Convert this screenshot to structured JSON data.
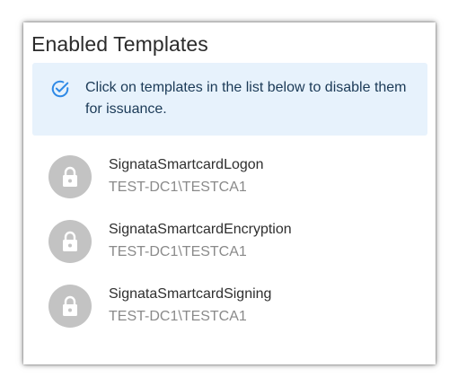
{
  "panel": {
    "title": "Enabled Templates"
  },
  "info": {
    "icon": "check-circle-icon",
    "accent_color": "#2f8ae6",
    "message": "Click on templates in the list below to disable them for issuance."
  },
  "templates": [
    {
      "name": "SignataSmartcardLogon",
      "ca": "TEST-DC1\\TESTCA1",
      "icon": "lock-icon"
    },
    {
      "name": "SignataSmartcardEncryption",
      "ca": "TEST-DC1\\TESTCA1",
      "icon": "lock-icon"
    },
    {
      "name": "SignataSmartcardSigning",
      "ca": "TEST-DC1\\TESTCA1",
      "icon": "lock-icon"
    }
  ]
}
